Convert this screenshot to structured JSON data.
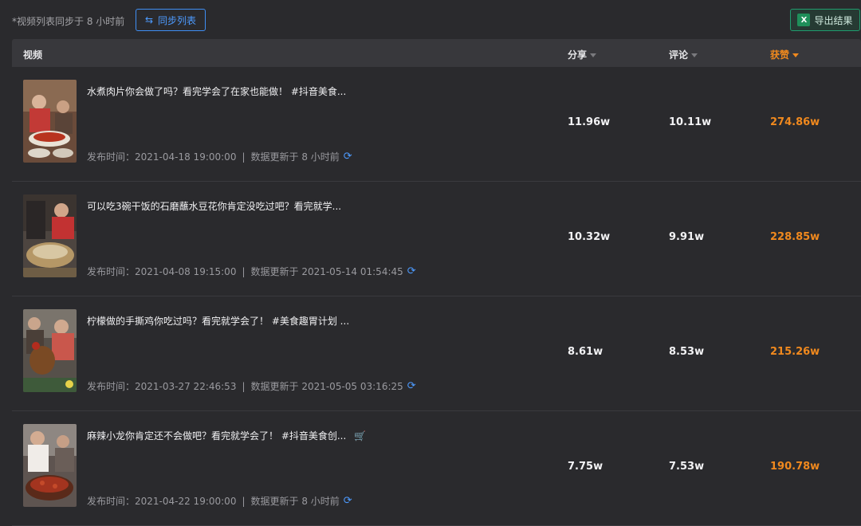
{
  "header": {
    "sync_note": "*视频列表同步于 8 小时前",
    "sync_button": "同步列表",
    "export_button": "导出结果",
    "excel_icon_letter": "X"
  },
  "columns": {
    "video": "视频",
    "share": "分享",
    "comment": "评论",
    "likes": "获赞"
  },
  "colors": {
    "accent_orange": "#f0891e",
    "accent_blue": "#4d9bff",
    "export_green": "#1f9d6e",
    "cart_yellow": "#f5b51b"
  },
  "rows": [
    {
      "title": "水煮肉片你会做了吗？看完学会了在家也能做！ #抖音美食...",
      "publish": "发布时间：2021-04-18 19:00:00",
      "updated": "数据更新于 8 小时前",
      "share": "11.96w",
      "comment": "10.11w",
      "likes": "274.86w",
      "cart": false
    },
    {
      "title": "可以吃3碗干饭的石磨蘸水豆花你肯定没吃过吧？看完就学...",
      "publish": "发布时间：2021-04-08 19:15:00",
      "updated": "数据更新于 2021-05-14 01:54:45",
      "share": "10.32w",
      "comment": "9.91w",
      "likes": "228.85w",
      "cart": false
    },
    {
      "title": "柠檬做的手撕鸡你吃过吗？看完就学会了！ #美食趣胃计划 ...",
      "publish": "发布时间：2021-03-27 22:46:53",
      "updated": "数据更新于 2021-05-05 03:16:25",
      "share": "8.61w",
      "comment": "8.53w",
      "likes": "215.26w",
      "cart": false
    },
    {
      "title": "麻辣小龙你肯定还不会做吧？看完就学会了！ #抖音美食创...",
      "publish": "发布时间：2021-04-22 19:00:00",
      "updated": "数据更新于 8 小时前",
      "share": "7.75w",
      "comment": "7.53w",
      "likes": "190.78w",
      "cart": true
    }
  ],
  "meta_separator": "|",
  "icons": {
    "sync": "swap-arrows-icon",
    "refresh": "refresh-icon",
    "cart": "shopping-cart-icon",
    "sort": "caret-down-icon"
  }
}
